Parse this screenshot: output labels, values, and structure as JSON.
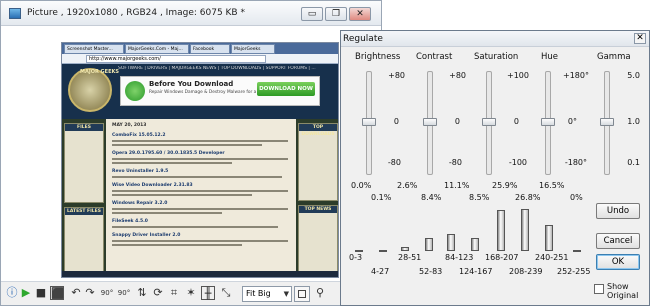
{
  "window": {
    "title": "Picture , 1920x1080 , RGB24 , Image: 6075 KB *",
    "buttons": {
      "minimize": "▭",
      "restore": "❐",
      "close": "✕"
    }
  },
  "screenshot_content": {
    "tabs": [
      "Screenshot Master...",
      "MajorGeeks.Com - Maj...",
      "Facebook",
      "MajorGeeks"
    ],
    "url": "http://www.majorgeeks.com/",
    "logo_text": "MAJOR GEEKS",
    "nav": "SOFTWARE | DRIVERS | MAJORGEEKS NEWS | TOP DOWNLOADS | SUPPORT FORUMS | ...",
    "ad_title": "Before You Download",
    "ad_subtitle": "Repair Windows Damage & Destroy Malware for a faster PC",
    "ad_button": "DOWNLOAD NOW",
    "left_box_1": "FILES",
    "left_box_2": "LATEST FILES",
    "right_box_1": "TOP DOWNLOADS",
    "right_box_2": "TOP NEWS",
    "center_date": "MAY 20, 2013",
    "headlines": [
      "ComboFix 15.05.12.2",
      "Opera 29.0.1795.60 / 30.0.1835.5 Developer",
      "Revo Uninstaller 1.9.5",
      "Wise Video Downloader 2.31.83",
      "Windows Repair 3.2.0",
      "FileSeek 4.5.0",
      "Snappy Driver Installer 2.0"
    ]
  },
  "toolbar": {
    "icons": [
      "info-icon",
      "play-icon",
      "stop-icon",
      "fullscreen-icon",
      "undo-icon",
      "redo-icon",
      "rotate-left-icon",
      "rotate-right-icon",
      "flip-icon",
      "crop-icon",
      "enhance-icon",
      "adjust-icon"
    ],
    "fit_select": {
      "value": "Fit Big",
      "options": [
        "Fit Big"
      ]
    },
    "labels": {
      "rotate_left": "90°",
      "rotate_right": "90°"
    }
  },
  "regulate": {
    "title": "Regulate",
    "close": "✕",
    "sliders": [
      {
        "name": "Brightness",
        "top": "+80",
        "mid": "0",
        "bottom": "-80",
        "value_above": "0.0%",
        "value_below": "0.1%"
      },
      {
        "name": "Contrast",
        "top": "+80",
        "mid": "0",
        "bottom": "-80",
        "value_above": "2.6%",
        "value_below": "8.4%"
      },
      {
        "name": "Saturation",
        "top": "+100",
        "mid": "0",
        "bottom": "-100",
        "value_above": "11.1%",
        "value_below": "8.5%"
      },
      {
        "name": "Hue",
        "top": "+180°",
        "mid": "0°",
        "bottom": "-180°",
        "value_above": "25.9%",
        "value_below": "16.5%"
      },
      {
        "name": "Gamma",
        "top": "5.0",
        "mid": "1.0",
        "bottom": "0.1",
        "value_above": "26.8%",
        "value_below": "0%"
      }
    ],
    "histogram": {
      "bins_top": [
        "0-3",
        "28-51",
        "84-123",
        "168-207",
        "240-251"
      ],
      "bins_bottom": [
        "4-27",
        "52-83",
        "124-167",
        "208-239",
        "252-255"
      ],
      "values_pct": [
        0.0,
        0.1,
        2.6,
        8.4,
        11.1,
        8.5,
        25.9,
        26.8,
        16.5,
        0
      ]
    },
    "buttons": {
      "undo": "Undo",
      "cancel": "Cancel",
      "ok": "OK"
    },
    "show_original": {
      "label_1": "Show",
      "label_2": "Original",
      "checked": false
    }
  }
}
